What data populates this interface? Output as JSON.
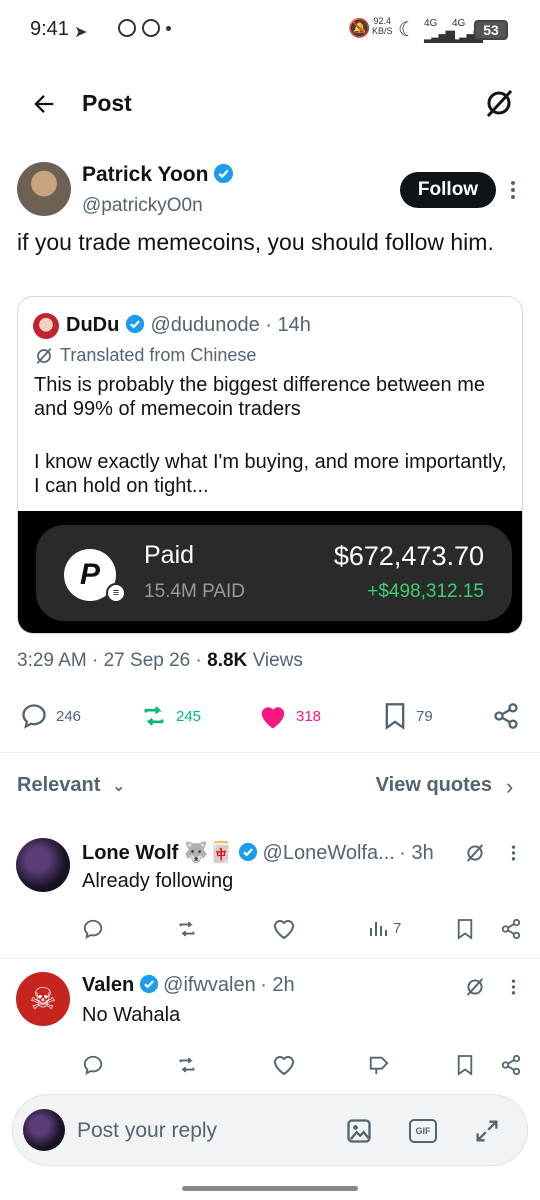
{
  "status_bar": {
    "time": "9:41",
    "net_speed": "92.4",
    "net_unit": "KB/S",
    "net1": "4G",
    "net2": "4G",
    "battery": "53"
  },
  "header": {
    "title": "Post"
  },
  "post": {
    "author_name": "Patrick Yoon",
    "author_handle": "@patrickyO0n",
    "follow_label": "Follow",
    "text": "if you trade memecoins, you should follow him.",
    "quote": {
      "name": "DuDu",
      "handle": "@dudunode",
      "time": "· 14h",
      "translated": "Translated from Chinese",
      "line1": "This is probably the biggest difference between me and 99% of memecoin traders",
      "line2": "I know exactly what I'm buying, and more importantly, I can hold on tight...",
      "card": {
        "title": "Paid",
        "subtitle": "15.4M PAID",
        "value": "$672,473.70",
        "gain": "+$498,312.15"
      }
    },
    "meta": {
      "time": "3:29 AM",
      "date": "27 Sep 26",
      "views_count": "8.8K",
      "views_label": "Views"
    },
    "actions": {
      "replies": "246",
      "reposts": "245",
      "likes": "318",
      "bookmarks": "79"
    }
  },
  "replies_header": {
    "sort_label": "Relevant",
    "view_quotes": "View quotes"
  },
  "replies": [
    {
      "name": "Lone Wolf 🐺🀄",
      "handle": "@LoneWolfa...",
      "time": "· 3h",
      "text": "Already following",
      "views": "7"
    },
    {
      "name": "Valen",
      "handle": "@ifwvalen",
      "time": "· 2h",
      "text": "No Wahala"
    }
  ],
  "composer": {
    "placeholder": "Post your reply"
  },
  "colors": {
    "accent": "#1d9bf0",
    "like": "#f91880",
    "repost": "#00ba7c",
    "gain": "#3ccf6c"
  }
}
